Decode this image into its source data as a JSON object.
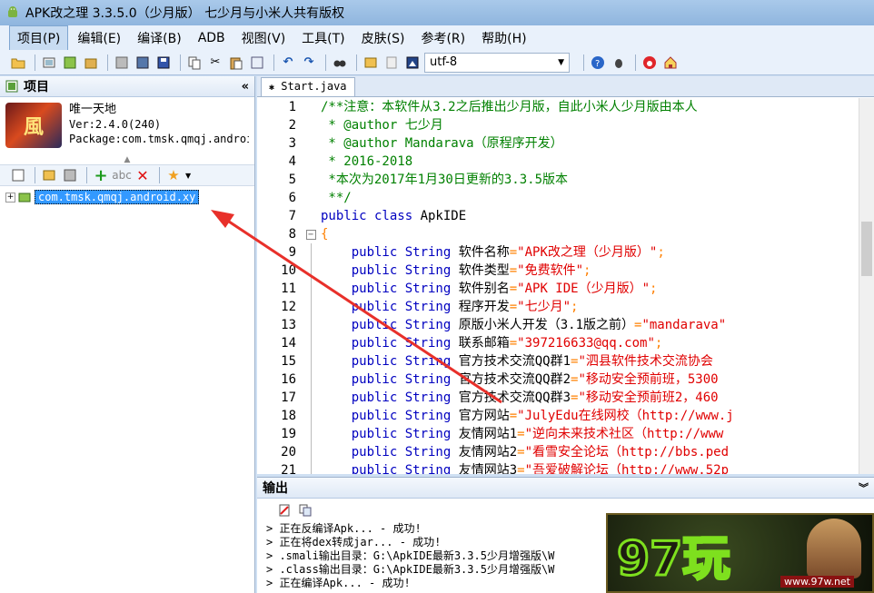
{
  "window": {
    "title": "APK改之理 3.3.5.0（少月版） 七少月与小米人共有版权"
  },
  "menu": [
    "项目(P)",
    "编辑(E)",
    "编译(B)",
    "ADB",
    "视图(V)",
    "工具(T)",
    "皮肤(S)",
    "参考(R)",
    "帮助(H)"
  ],
  "toolbar": {
    "encoding": "utf-8"
  },
  "project_panel": {
    "title": "项目",
    "app_name": "唯一天地",
    "version": "Ver:2.4.0(240)",
    "package": "Package:com.tmsk.qmqj.android.xy",
    "tree_node": "com.tmsk.qmqj.android.xy"
  },
  "editor": {
    "tab": "Start.java",
    "lines": [
      [
        {
          "t": "/**注意：本软件从3.2之后推出少月版，自此小米人少月版由本人",
          "c": "comment"
        }
      ],
      [
        {
          "t": " * @author 七少月",
          "c": "comment"
        }
      ],
      [
        {
          "t": " * @author Mandarava（原程序开发）",
          "c": "comment"
        }
      ],
      [
        {
          "t": " * 2016-2018",
          "c": "comment"
        }
      ],
      [
        {
          "t": " *本次为2017年1月30日更新的3.3.5版本",
          "c": "comment"
        }
      ],
      [
        {
          "t": " **/",
          "c": "comment"
        }
      ],
      [
        {
          "t": "public class ",
          "c": "kw"
        },
        {
          "t": "ApkIDE",
          "c": "id"
        }
      ],
      [
        {
          "t": "{",
          "c": "brace"
        }
      ],
      [
        {
          "t": "    public String ",
          "c": "kw"
        },
        {
          "t": "软件名称",
          "c": "id"
        },
        {
          "t": "=",
          "c": "brace"
        },
        {
          "t": "\"APK改之理（少月版）\"",
          "c": "str"
        },
        {
          "t": ";",
          "c": "brace"
        }
      ],
      [
        {
          "t": "    public String ",
          "c": "kw"
        },
        {
          "t": "软件类型",
          "c": "id"
        },
        {
          "t": "=",
          "c": "brace"
        },
        {
          "t": "\"免费软件\"",
          "c": "str"
        },
        {
          "t": ";",
          "c": "brace"
        }
      ],
      [
        {
          "t": "    public String ",
          "c": "kw"
        },
        {
          "t": "软件别名",
          "c": "id"
        },
        {
          "t": "=",
          "c": "brace"
        },
        {
          "t": "\"APK IDE（少月版）\"",
          "c": "str"
        },
        {
          "t": ";",
          "c": "brace"
        }
      ],
      [
        {
          "t": "    public String ",
          "c": "kw"
        },
        {
          "t": "程序开发",
          "c": "id"
        },
        {
          "t": "=",
          "c": "brace"
        },
        {
          "t": "\"七少月\"",
          "c": "str"
        },
        {
          "t": ";",
          "c": "brace"
        }
      ],
      [
        {
          "t": "    public String ",
          "c": "kw"
        },
        {
          "t": "原版小米人开发（3.1版之前）",
          "c": "id"
        },
        {
          "t": "=",
          "c": "brace"
        },
        {
          "t": "\"mandarava\"",
          "c": "str"
        }
      ],
      [
        {
          "t": "    public String ",
          "c": "kw"
        },
        {
          "t": "联系邮箱",
          "c": "id"
        },
        {
          "t": "=",
          "c": "brace"
        },
        {
          "t": "\"397216633@qq.com\"",
          "c": "str"
        },
        {
          "t": ";",
          "c": "brace"
        }
      ],
      [
        {
          "t": "    public String ",
          "c": "kw"
        },
        {
          "t": "官方技术交流QQ群1",
          "c": "id"
        },
        {
          "t": "=",
          "c": "brace"
        },
        {
          "t": "\"泗县软件技术交流协会",
          "c": "str"
        }
      ],
      [
        {
          "t": "    public String ",
          "c": "kw"
        },
        {
          "t": "官方技术交流QQ群2",
          "c": "id"
        },
        {
          "t": "=",
          "c": "brace"
        },
        {
          "t": "\"移动安全预前班，5300",
          "c": "str"
        }
      ],
      [
        {
          "t": "    public String ",
          "c": "kw"
        },
        {
          "t": "官方技术交流QQ群3",
          "c": "id"
        },
        {
          "t": "=",
          "c": "brace"
        },
        {
          "t": "\"移动安全预前班2，460",
          "c": "str"
        }
      ],
      [
        {
          "t": "    public String ",
          "c": "kw"
        },
        {
          "t": "官方网站",
          "c": "id"
        },
        {
          "t": "=",
          "c": "brace"
        },
        {
          "t": "\"JulyEdu在线网校（http://www.j",
          "c": "str"
        }
      ],
      [
        {
          "t": "    public String ",
          "c": "kw"
        },
        {
          "t": "友情网站1",
          "c": "id"
        },
        {
          "t": "=",
          "c": "brace"
        },
        {
          "t": "\"逆向未来技术社区（http://www",
          "c": "str"
        }
      ],
      [
        {
          "t": "    public String ",
          "c": "kw"
        },
        {
          "t": "友情网站2",
          "c": "id"
        },
        {
          "t": "=",
          "c": "brace"
        },
        {
          "t": "\"看雪安全论坛（http://bbs.ped",
          "c": "str"
        }
      ],
      [
        {
          "t": "    public String ",
          "c": "kw"
        },
        {
          "t": "友情网站3",
          "c": "id"
        },
        {
          "t": "=",
          "c": "brace"
        },
        {
          "t": "\"吾爱破解论坛（http://www.52p",
          "c": "str"
        }
      ]
    ]
  },
  "output": {
    "title": "输出",
    "lines": [
      "> 正在反编译Apk...  - 成功!",
      "> 正在将dex转成jar...  - 成功!",
      "> .smali输出目录：G:\\ApkIDE最新3.3.5少月增强版\\W",
      "> .class输出目录：G:\\ApkIDE最新3.3.5少月增强版\\W",
      "> 正在编译Apk...  - 成功!"
    ]
  },
  "watermark": {
    "text": "97玩",
    "url": "www.97w.net"
  },
  "colors": {
    "title_bar": "#a9c9ea",
    "selection": "#3399ff",
    "annotation_arrow": "#e8302a"
  }
}
